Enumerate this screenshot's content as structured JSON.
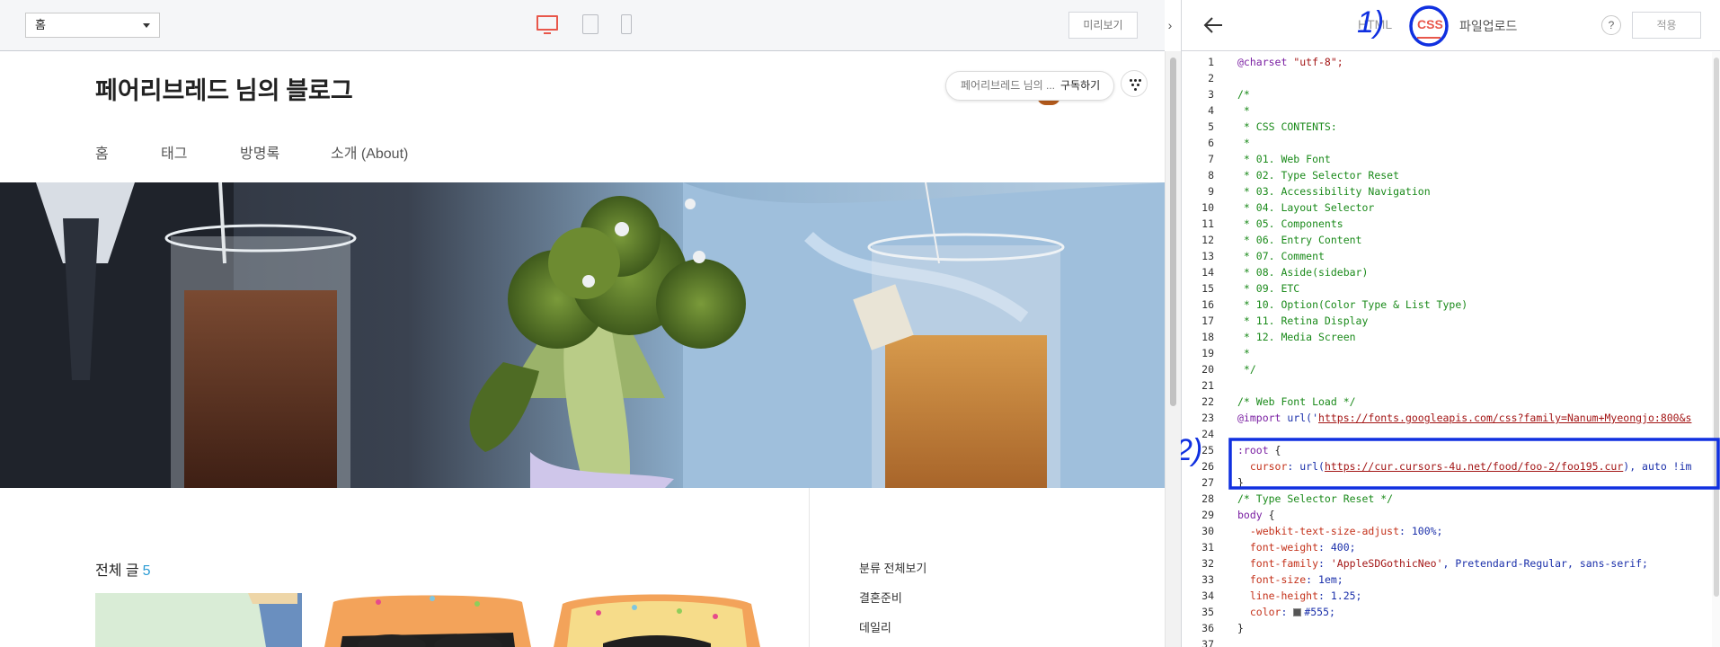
{
  "preview_toolbar": {
    "page_select_value": "홈",
    "preview_label": "미리보기",
    "collapse_icon": "chevron-right-icon"
  },
  "blog": {
    "title": "페어리브레드 님의 블로그",
    "subscribe_nickname": "페어리브레드 님의 ...",
    "subscribe_label": "구독하기",
    "nav": [
      "홈",
      "태그",
      "방명록",
      "소개 (About)"
    ],
    "all_posts_label": "전체 글",
    "all_posts_count": "5",
    "categories": [
      "분류 전체보기",
      "결혼준비",
      "데일리"
    ]
  },
  "editor": {
    "tabs": {
      "html": "HTML",
      "css": "CSS",
      "upload": "파일업로드"
    },
    "help_label": "?",
    "apply_label": "적용",
    "active_tab": "CSS",
    "line_numbers": [
      "1",
      "2",
      "3",
      "4",
      "5",
      "6",
      "7",
      "8",
      "9",
      "10",
      "11",
      "12",
      "13",
      "14",
      "15",
      "16",
      "17",
      "18",
      "19",
      "20",
      "21",
      "22",
      "23",
      "24",
      "25",
      "26",
      "27",
      "28",
      "29",
      "30",
      "31",
      "32",
      "33",
      "34",
      "35",
      "36",
      "37"
    ],
    "code": [
      [
        {
          "t": "@charset",
          "c": "at"
        },
        {
          "t": " \"utf-8\";",
          "c": "str"
        }
      ],
      [],
      [
        {
          "t": "/*",
          "c": "cm"
        }
      ],
      [
        {
          "t": " *",
          "c": "cm"
        }
      ],
      [
        {
          "t": " * CSS CONTENTS:",
          "c": "cm"
        }
      ],
      [
        {
          "t": " *",
          "c": "cm"
        }
      ],
      [
        {
          "t": " * 01. Web Font",
          "c": "cm"
        }
      ],
      [
        {
          "t": " * 02. Type Selector Reset",
          "c": "cm"
        }
      ],
      [
        {
          "t": " * 03. Accessibility Navigation",
          "c": "cm"
        }
      ],
      [
        {
          "t": " * 04. Layout Selector",
          "c": "cm"
        }
      ],
      [
        {
          "t": " * 05. Components",
          "c": "cm"
        }
      ],
      [
        {
          "t": " * 06. Entry Content",
          "c": "cm"
        }
      ],
      [
        {
          "t": " * 07. Comment",
          "c": "cm"
        }
      ],
      [
        {
          "t": " * 08. Aside(sidebar)",
          "c": "cm"
        }
      ],
      [
        {
          "t": " * 09. ETC",
          "c": "cm"
        }
      ],
      [
        {
          "t": " * 10. Option(Color Type & List Type)",
          "c": "cm"
        }
      ],
      [
        {
          "t": " * 11. Retina Display",
          "c": "cm"
        }
      ],
      [
        {
          "t": " * 12. Media Screen",
          "c": "cm"
        }
      ],
      [
        {
          "t": " *",
          "c": "cm"
        }
      ],
      [
        {
          "t": " */",
          "c": "cm"
        }
      ],
      [],
      [
        {
          "t": "/* Web Font Load */",
          "c": "cm"
        }
      ],
      [
        {
          "t": "@import",
          "c": "at"
        },
        {
          "t": " url('",
          "c": "val"
        },
        {
          "t": "https://fonts.googleapis.com/css?family=Nanum+Myeongjo:800&s",
          "c": "url"
        }
      ],
      [],
      [
        {
          "t": ":root",
          "c": "sel"
        },
        {
          "t": " {",
          "c": "pl"
        }
      ],
      [
        {
          "t": "  cursor",
          "c": "prop"
        },
        {
          "t": ": url(",
          "c": "val"
        },
        {
          "t": "https://cur.cursors-4u.net/food/foo-2/foo195.cur",
          "c": "url"
        },
        {
          "t": "), auto !im",
          "c": "val"
        }
      ],
      [
        {
          "t": "}",
          "c": "pl"
        }
      ],
      [
        {
          "t": "/* Type Selector Reset */",
          "c": "cm"
        }
      ],
      [
        {
          "t": "body",
          "c": "sel"
        },
        {
          "t": " {",
          "c": "pl"
        }
      ],
      [
        {
          "t": "  -webkit-text-size-adjust",
          "c": "prop"
        },
        {
          "t": ": 100%;",
          "c": "val"
        }
      ],
      [
        {
          "t": "  font-weight",
          "c": "prop"
        },
        {
          "t": ": 400;",
          "c": "val"
        }
      ],
      [
        {
          "t": "  font-family",
          "c": "prop"
        },
        {
          "t": ": ",
          "c": "val"
        },
        {
          "t": "'AppleSDGothicNeo'",
          "c": "str"
        },
        {
          "t": ", Pretendard-Regular, sans-serif;",
          "c": "val"
        }
      ],
      [
        {
          "t": "  font-size",
          "c": "prop"
        },
        {
          "t": ": 1em;",
          "c": "val"
        }
      ],
      [
        {
          "t": "  line-height",
          "c": "prop"
        },
        {
          "t": ": 1.25;",
          "c": "val"
        }
      ],
      [
        {
          "t": "  color",
          "c": "prop"
        },
        {
          "t": ": ",
          "c": "val"
        },
        {
          "t": "",
          "c": "swatch"
        },
        {
          "t": "#555;",
          "c": "val"
        }
      ],
      [
        {
          "t": "}",
          "c": "pl"
        }
      ],
      []
    ]
  },
  "annotations": {
    "mark_1": "1)",
    "mark_2": "2)"
  },
  "colors": {
    "accent_red": "#e8574b",
    "annotation_blue": "#1030e0",
    "link_blue": "#2b9bd3"
  }
}
